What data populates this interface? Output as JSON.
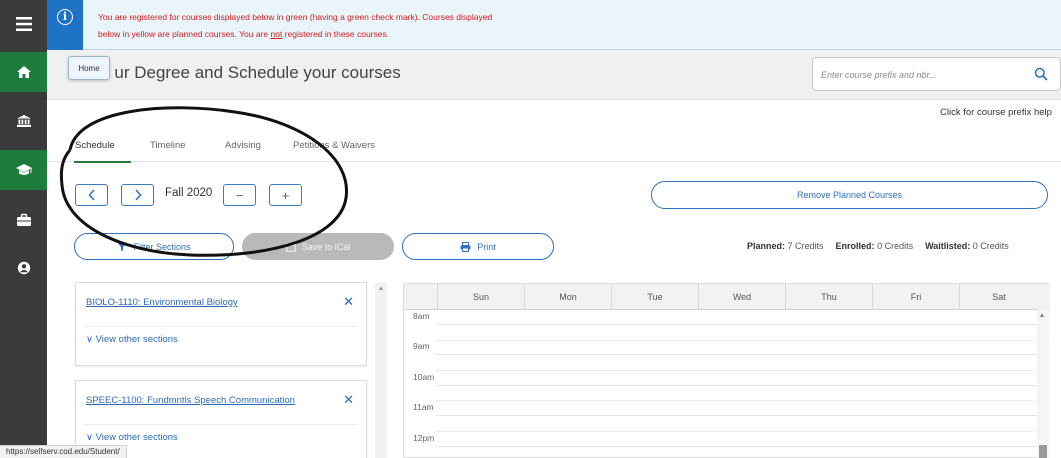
{
  "banner": {
    "line1": "You are registered for courses displayed below in green (having a green check mark). Courses displayed",
    "line2_pre": "below in yellow are planned courses. You are ",
    "line2_emph": "not",
    "line2_post": " registered in these courses."
  },
  "sidebar": {
    "items": [
      {
        "icon": "menu-icon"
      },
      {
        "icon": "home-icon",
        "active": true
      },
      {
        "icon": "bank-icon"
      },
      {
        "icon": "graduation-cap-icon",
        "active": true
      },
      {
        "icon": "briefcase-icon"
      },
      {
        "icon": "user-icon"
      }
    ]
  },
  "tooltip": {
    "home": "Home"
  },
  "header": {
    "title": "P      ur Degree and Schedule your courses",
    "search_placeholder": "Enter course prefix and nbr...",
    "prefix_help": "Click for course prefix help"
  },
  "tabs": [
    {
      "label": "Schedule",
      "active": true
    },
    {
      "label": "Timeline"
    },
    {
      "label": "Advising"
    },
    {
      "label": "Petitions & Waivers"
    }
  ],
  "term": {
    "prev": "<",
    "next": ">",
    "label": "Fall 2020",
    "remove": "−",
    "add": "+"
  },
  "actions": {
    "remove_planned": "Remove Planned Courses",
    "filter_sections": "Filter Sections",
    "save_ical": "Save to iCal",
    "print": "Print"
  },
  "credits": {
    "planned_label": "Planned:",
    "planned_value": "7 Credits",
    "enrolled_label": "Enrolled:",
    "enrolled_value": "0 Credits",
    "waitlisted_label": "Waitlisted:",
    "waitlisted_value": "0 Credits"
  },
  "courses": [
    {
      "title": "BIOLO-1110: Environmental Biology",
      "link": "View other sections"
    },
    {
      "title": "SPEEC-1100: Fundmntls Speech Communication",
      "link": "View other sections"
    }
  ],
  "calendar": {
    "days": [
      "Sun",
      "Mon",
      "Tue",
      "Wed",
      "Thu",
      "Fri",
      "Sat"
    ],
    "times": [
      "8am",
      "9am",
      "10am",
      "11am",
      "12pm"
    ]
  },
  "status_url": "https://selfserv.cod.edu/Student/",
  "colors": {
    "brand_green": "#1e7d3d",
    "link_blue": "#2a6bb9",
    "banner_text_red": "#d21f1f",
    "sidebar_dark": "#3b3b3b"
  }
}
